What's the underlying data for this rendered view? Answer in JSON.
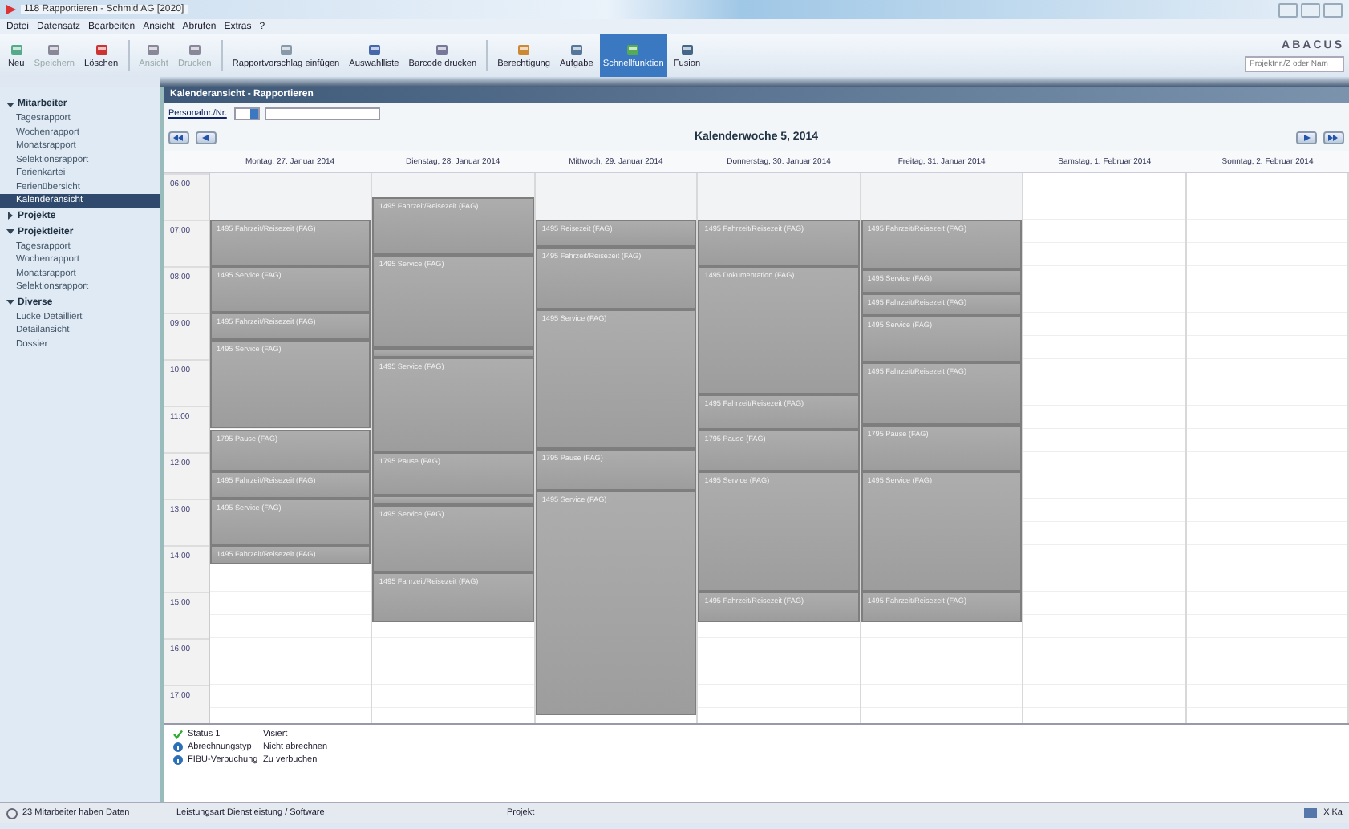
{
  "window": {
    "title": "118 Rapportieren - Schmid AG [2020]"
  },
  "menu": [
    "Datei",
    "Datensatz",
    "Bearbeiten",
    "Ansicht",
    "Abrufen",
    "Extras",
    "?"
  ],
  "toolbar": [
    {
      "kind": "button",
      "label": "Neu",
      "disabled": false,
      "selected": false
    },
    {
      "kind": "button",
      "label": "Speichern",
      "disabled": true,
      "selected": false
    },
    {
      "kind": "button",
      "label": "Löschen",
      "disabled": false,
      "selected": false
    },
    {
      "kind": "separator"
    },
    {
      "kind": "button",
      "label": "Ansicht",
      "disabled": true,
      "selected": false
    },
    {
      "kind": "button",
      "label": "Drucken",
      "disabled": true,
      "selected": false
    },
    {
      "kind": "separator"
    },
    {
      "kind": "button",
      "label": "Rapportvorschlag einfügen",
      "disabled": false,
      "selected": false
    },
    {
      "kind": "button",
      "label": "Auswahlliste",
      "disabled": false,
      "selected": false
    },
    {
      "kind": "button",
      "label": "Barcode drucken",
      "disabled": false,
      "selected": false
    },
    {
      "kind": "separator"
    },
    {
      "kind": "button",
      "label": "Berechtigung",
      "disabled": false,
      "selected": false
    },
    {
      "kind": "button",
      "label": "Aufgabe",
      "disabled": false,
      "selected": false
    },
    {
      "kind": "button",
      "label": "Schnellfunktion",
      "disabled": false,
      "selected": true
    },
    {
      "kind": "button",
      "label": "Fusion",
      "disabled": false,
      "selected": false
    }
  ],
  "brand": "ABACUS",
  "search": {
    "placeholder": "Projektnr./Z oder Nam"
  },
  "sidebar": {
    "groups": [
      {
        "label": "Mitarbeiter",
        "expanded": true,
        "items": [
          {
            "label": "Tagesrapport",
            "selected": false
          },
          {
            "label": "Wochenrapport",
            "selected": false
          },
          {
            "label": "Monatsrapport",
            "selected": false
          },
          {
            "label": "Selektionsrapport",
            "selected": false
          },
          {
            "label": "Ferienkartei",
            "selected": false
          },
          {
            "label": "Ferienübersicht",
            "selected": false
          },
          {
            "label": "Kalenderansicht",
            "selected": true
          }
        ]
      },
      {
        "label": "Projekte",
        "expanded": false
      },
      {
        "label": "Projektleiter",
        "expanded": true,
        "items": [
          {
            "label": "Tagesrapport",
            "selected": false
          },
          {
            "label": "Wochenrapport",
            "selected": false
          },
          {
            "label": "Monatsrapport",
            "selected": false
          },
          {
            "label": "Selektionsrapport",
            "selected": false
          }
        ]
      },
      {
        "label": "Diverse",
        "expanded": true,
        "items": [
          {
            "label": "Lücke Detailliert",
            "selected": false
          },
          {
            "label": "Detailansicht",
            "selected": false
          },
          {
            "label": "Dossier",
            "selected": false
          }
        ]
      }
    ]
  },
  "panel": {
    "title": "Kalenderansicht - Rapportieren",
    "filter_label": "Personalnr./Nr.",
    "week_title": "Kalenderwoche 5, 2014"
  },
  "calendar": {
    "hours": [
      "06:00",
      "07:00",
      "08:00",
      "09:00",
      "10:00",
      "11:00",
      "12:00",
      "13:00",
      "14:00",
      "15:00",
      "16:00",
      "17:00"
    ],
    "days": [
      {
        "label": "Montag, 27. Januar 2014",
        "weekend": false,
        "events": [
          {
            "kind": "entry",
            "title": "1495 Fahrzeit/Reisezeit (FAG)"
          },
          {
            "kind": "entry",
            "title": "1495 Service (FAG)"
          },
          {
            "kind": "entry",
            "title": "1495 Fahrzeit/Reisezeit (FAG)"
          },
          {
            "kind": "entry",
            "title": "1495 Service (FAG)"
          },
          {
            "kind": "entry",
            "title": "1795 Pause (FAG)"
          },
          {
            "kind": "entry",
            "title": "1495 Fahrzeit/Reisezeit (FAG)"
          },
          {
            "kind": "entry",
            "title": "1495 Service (FAG)"
          },
          {
            "kind": "entry",
            "title": "1495 Fahrzeit/Reisezeit (FAG)"
          }
        ]
      },
      {
        "label": "Dienstag, 28. Januar 2014",
        "weekend": false,
        "events": [
          {
            "kind": "entry",
            "title": "1495 Fahrzeit/Reisezeit (FAG)"
          },
          {
            "kind": "entry",
            "title": "1495 Service (FAG)"
          },
          {
            "kind": "sliver"
          },
          {
            "kind": "entry",
            "title": "1495 Service (FAG)"
          },
          {
            "kind": "entry",
            "title": "1795 Pause (FAG)"
          },
          {
            "kind": "sliver"
          },
          {
            "kind": "entry",
            "title": "1495 Service (FAG)"
          },
          {
            "kind": "entry",
            "title": "1495 Fahrzeit/Reisezeit (FAG)"
          }
        ]
      },
      {
        "label": "Mittwoch, 29. Januar 2014",
        "weekend": false,
        "events": [
          {
            "kind": "entry",
            "title": "1495 Reisezeit (FAG)"
          },
          {
            "kind": "entry",
            "title": "1495 Fahrzeit/Reisezeit (FAG)"
          },
          {
            "kind": "entry",
            "title": "1495 Service (FAG)"
          },
          {
            "kind": "entry",
            "title": "1795 Pause (FAG)"
          },
          {
            "kind": "entry",
            "title": "1495 Service (FAG)"
          }
        ]
      },
      {
        "label": "Donnerstag, 30. Januar 2014",
        "weekend": false,
        "events": [
          {
            "kind": "entry",
            "title": "1495 Fahrzeit/Reisezeit (FAG)"
          },
          {
            "kind": "entry",
            "title": "1495 Dokumentation (FAG)"
          },
          {
            "kind": "entry",
            "title": "1495 Fahrzeit/Reisezeit (FAG)"
          },
          {
            "kind": "entry",
            "title": "1795 Pause (FAG)"
          },
          {
            "kind": "entry",
            "title": "1495 Service (FAG)"
          },
          {
            "kind": "entry",
            "title": "1495 Fahrzeit/Reisezeit (FAG)"
          }
        ]
      },
      {
        "label": "Freitag, 31. Januar 2014",
        "weekend": false,
        "events": [
          {
            "kind": "entry",
            "title": "1495 Fahrzeit/Reisezeit (FAG)"
          },
          {
            "kind": "entry",
            "title": "1495 Service (FAG)"
          },
          {
            "kind": "entry",
            "title": "1495 Fahrzeit/Reisezeit (FAG)"
          },
          {
            "kind": "entry",
            "title": "1495 Service (FAG)"
          },
          {
            "kind": "entry",
            "title": "1495 Fahrzeit/Reisezeit (FAG)"
          },
          {
            "kind": "entry",
            "title": "1795 Pause (FAG)"
          },
          {
            "kind": "entry",
            "title": "1495 Service (FAG)"
          },
          {
            "kind": "entry",
            "title": "1495 Fahrzeit/Reisezeit (FAG)"
          }
        ]
      },
      {
        "label": "Samstag, 1. Februar 2014",
        "weekend": true
      },
      {
        "label": "Sonntag, 2. Februar 2014",
        "weekend": true
      }
    ]
  },
  "details": [
    {
      "kind": "check",
      "label": "Status 1",
      "value": "Visiert"
    },
    {
      "kind": "info",
      "label": "Abrechnungstyp",
      "value": "Nicht abrechnen"
    },
    {
      "kind": "info",
      "label": "FIBU-Verbuchung",
      "value": "Zu verbuchen"
    }
  ],
  "status_bar": {
    "message": "23 Mitarbeiter haben Daten",
    "service": "Leistungsart Dienstleistung / Software",
    "project": "Projekt",
    "right": "X Ka"
  }
}
